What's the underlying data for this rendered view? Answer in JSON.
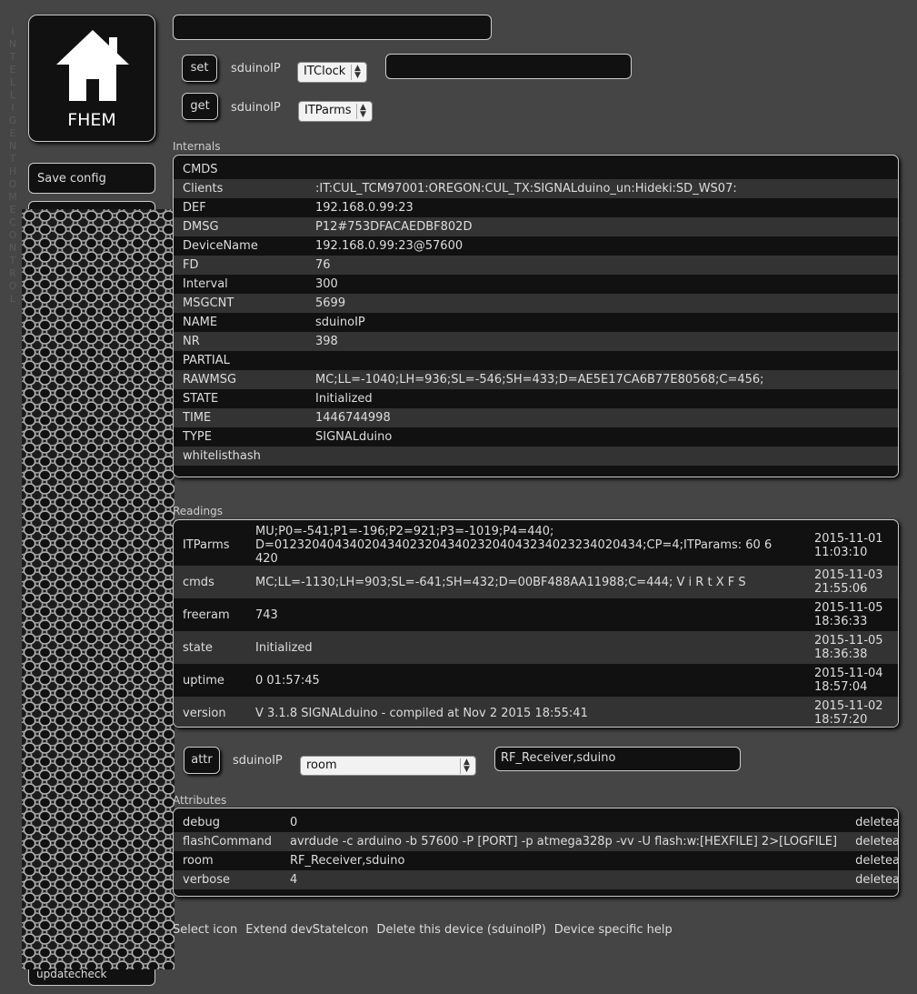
{
  "brand": {
    "vertical_text": [
      "I",
      "N",
      "T",
      "E",
      "L",
      "L",
      "I",
      "G",
      "E",
      "N",
      "T",
      "",
      "H",
      "O",
      "M",
      "E",
      "",
      "C",
      "O",
      "N",
      "T",
      "R",
      "O",
      "L"
    ],
    "logo_label": "FHEM"
  },
  "sidebar": {
    "save_label": "Save config",
    "last_item": "updatecheck"
  },
  "command_input": {
    "value": ""
  },
  "set_row": {
    "button": "set",
    "device": "sduinoIP",
    "selected": "ITClock",
    "value": ""
  },
  "get_row": {
    "button": "get",
    "device": "sduinoIP",
    "selected": "ITParms"
  },
  "internals": {
    "title": "Internals",
    "rows": [
      {
        "key": "CMDS",
        "value": ""
      },
      {
        "key": "Clients",
        "value": ":IT:CUL_TCM97001:OREGON:CUL_TX:SIGNALduino_un:Hideki:SD_WS07:"
      },
      {
        "key": "DEF",
        "value": "192.168.0.99:23"
      },
      {
        "key": "DMSG",
        "value": "P12#753DFACAEDBF802D"
      },
      {
        "key": "DeviceName",
        "value": "192.168.0.99:23@57600"
      },
      {
        "key": "FD",
        "value": "76"
      },
      {
        "key": "Interval",
        "value": "300"
      },
      {
        "key": "MSGCNT",
        "value": "5699"
      },
      {
        "key": "NAME",
        "value": "sduinoIP"
      },
      {
        "key": "NR",
        "value": "398"
      },
      {
        "key": "PARTIAL",
        "value": ""
      },
      {
        "key": "RAWMSG",
        "value": "MC;LL=-1040;LH=936;SL=-546;SH=433;D=AE5E17CA6B77E80568;C=456;"
      },
      {
        "key": "STATE",
        "value": "Initialized"
      },
      {
        "key": "TIME",
        "value": "1446744998"
      },
      {
        "key": "TYPE",
        "value": "SIGNALduino"
      },
      {
        "key": "whitelisthash",
        "value": ""
      }
    ]
  },
  "readings": {
    "title": "Readings",
    "rows": [
      {
        "key": "ITParms",
        "value": "MU;P0=-541;P1=-196;P2=921;P3=-1019;P4=440; D=0123204043402043402320434023204043234023234020434;CP=4;ITParams: 60 6 420",
        "date": "2015-11-01",
        "time": "11:03:10"
      },
      {
        "key": "cmds",
        "value": "MC;LL=-1130;LH=903;SL=-641;SH=432;D=00BF488AA11988;C=444; V i R t X F S",
        "date": "2015-11-03",
        "time": "21:55:06"
      },
      {
        "key": "freeram",
        "value": "743",
        "date": "2015-11-05",
        "time": "18:36:33"
      },
      {
        "key": "state",
        "value": "Initialized",
        "date": "2015-11-05",
        "time": "18:36:38"
      },
      {
        "key": "uptime",
        "value": "0 01:57:45",
        "date": "2015-11-04",
        "time": "18:57:04"
      },
      {
        "key": "version",
        "value": "V 3.1.8 SIGNALduino - compiled at Nov 2 2015 18:55:41",
        "date": "2015-11-02",
        "time": "18:57:20"
      }
    ]
  },
  "attr_row": {
    "button": "attr",
    "device": "sduinoIP",
    "selected": "room",
    "value": "RF_Receiver,sduino"
  },
  "attributes": {
    "title": "Attributes",
    "delete_label": "deleteattr",
    "rows": [
      {
        "key": "debug",
        "value": "0"
      },
      {
        "key": "flashCommand",
        "value": "avrdude -c arduino -b 57600 -P [PORT] -p atmega328p -vv -U flash:w:[HEXFILE] 2>[LOGFILE]"
      },
      {
        "key": "room",
        "value": "RF_Receiver,sduino"
      },
      {
        "key": "verbose",
        "value": "4"
      }
    ]
  },
  "links": [
    "Select icon",
    "Extend devStateIcon",
    "Delete this device (sduinoIP)",
    "Device specific help"
  ]
}
